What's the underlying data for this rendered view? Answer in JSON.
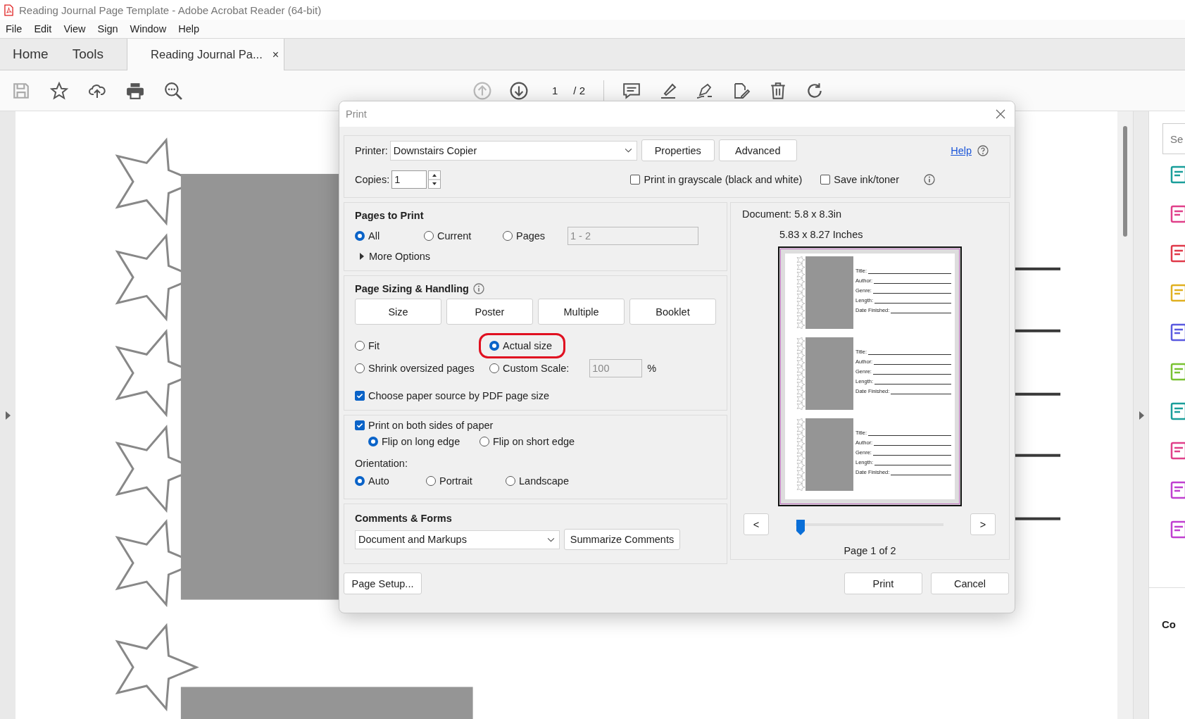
{
  "window": {
    "title": "Reading Journal Page Template - Adobe Acrobat Reader (64-bit)"
  },
  "menu": [
    "File",
    "Edit",
    "View",
    "Sign",
    "Window",
    "Help"
  ],
  "tabs": [
    {
      "label": "Home",
      "kind": "nav",
      "selected": false
    },
    {
      "label": "Tools",
      "kind": "nav",
      "selected": false
    },
    {
      "label": "Reading Journal Pa...",
      "kind": "document",
      "selected": true,
      "close": "×"
    }
  ],
  "toolbar": {
    "page": "1",
    "total": "/ 2"
  },
  "dialog": {
    "title": "Print",
    "printer": {
      "label": "Printer:",
      "value": "Downstairs Copier"
    },
    "top_buttons": [
      "Properties",
      "Advanced"
    ],
    "help": "Help",
    "copies": {
      "label": "Copies:",
      "value": "1"
    },
    "top_options": [
      {
        "label": "Print in grayscale (black and white)",
        "checked": false
      },
      {
        "label": "Save ink/toner",
        "checked": false
      }
    ],
    "pages_to_print": {
      "title": "Pages to Print",
      "options": [
        {
          "label": "All",
          "selected": true
        },
        {
          "label": "Current",
          "selected": false
        },
        {
          "label": "Pages",
          "selected": false
        }
      ],
      "range": "1 - 2",
      "more": "More Options",
      "expanded": false
    },
    "sizing": {
      "title": "Page Sizing & Handling",
      "modes": [
        "Size",
        "Poster",
        "Multiple",
        "Booklet"
      ],
      "options": [
        {
          "label": "Fit",
          "kind": "radio",
          "selected": false,
          "highlighted": false
        },
        {
          "label": "Actual size",
          "kind": "radio",
          "selected": true,
          "highlighted": true
        },
        {
          "label": "Shrink oversized pages",
          "kind": "radio",
          "selected": false,
          "highlighted": false
        },
        {
          "label": "Custom Scale:",
          "kind": "scale",
          "selected": false,
          "highlighted": false,
          "value": "100",
          "unit": "%"
        }
      ],
      "paper_source": {
        "label": "Choose paper source by PDF page size",
        "checked": true
      }
    },
    "duplex": {
      "label": "Print on both sides of paper",
      "checked": true,
      "options": [
        {
          "label": "Flip on long edge",
          "selected": true
        },
        {
          "label": "Flip on short edge",
          "selected": false
        }
      ]
    },
    "orientation": {
      "label": "Orientation:",
      "options": [
        {
          "label": "Auto",
          "selected": true
        },
        {
          "label": "Portrait",
          "selected": false
        },
        {
          "label": "Landscape",
          "selected": false
        }
      ]
    },
    "comments": {
      "title": "Comments & Forms",
      "value": "Document and Markups",
      "button": "Summarize Comments"
    },
    "preview": {
      "document": "Document: 5.8 x 8.3in",
      "size": "5.83 x 8.27 Inches",
      "blocks": [
        {
          "fields": [
            "Title:",
            "Author:",
            "Genre:",
            "Length:",
            "Date Finished:"
          ]
        },
        {
          "fields": [
            "Title:",
            "Author:",
            "Genre:",
            "Length:",
            "Date Finished:"
          ]
        },
        {
          "fields": [
            "Title:",
            "Author:",
            "Genre:",
            "Length:",
            "Date Finished:"
          ]
        }
      ],
      "prev": "<",
      "next": ">",
      "level": 0,
      "page_label": "Page 1 of 2"
    },
    "footer": {
      "setup": "Page Setup...",
      "buttons": [
        "Print",
        "Cancel"
      ]
    }
  },
  "side_panel": {
    "placeholder": "Se",
    "text": "Co"
  }
}
